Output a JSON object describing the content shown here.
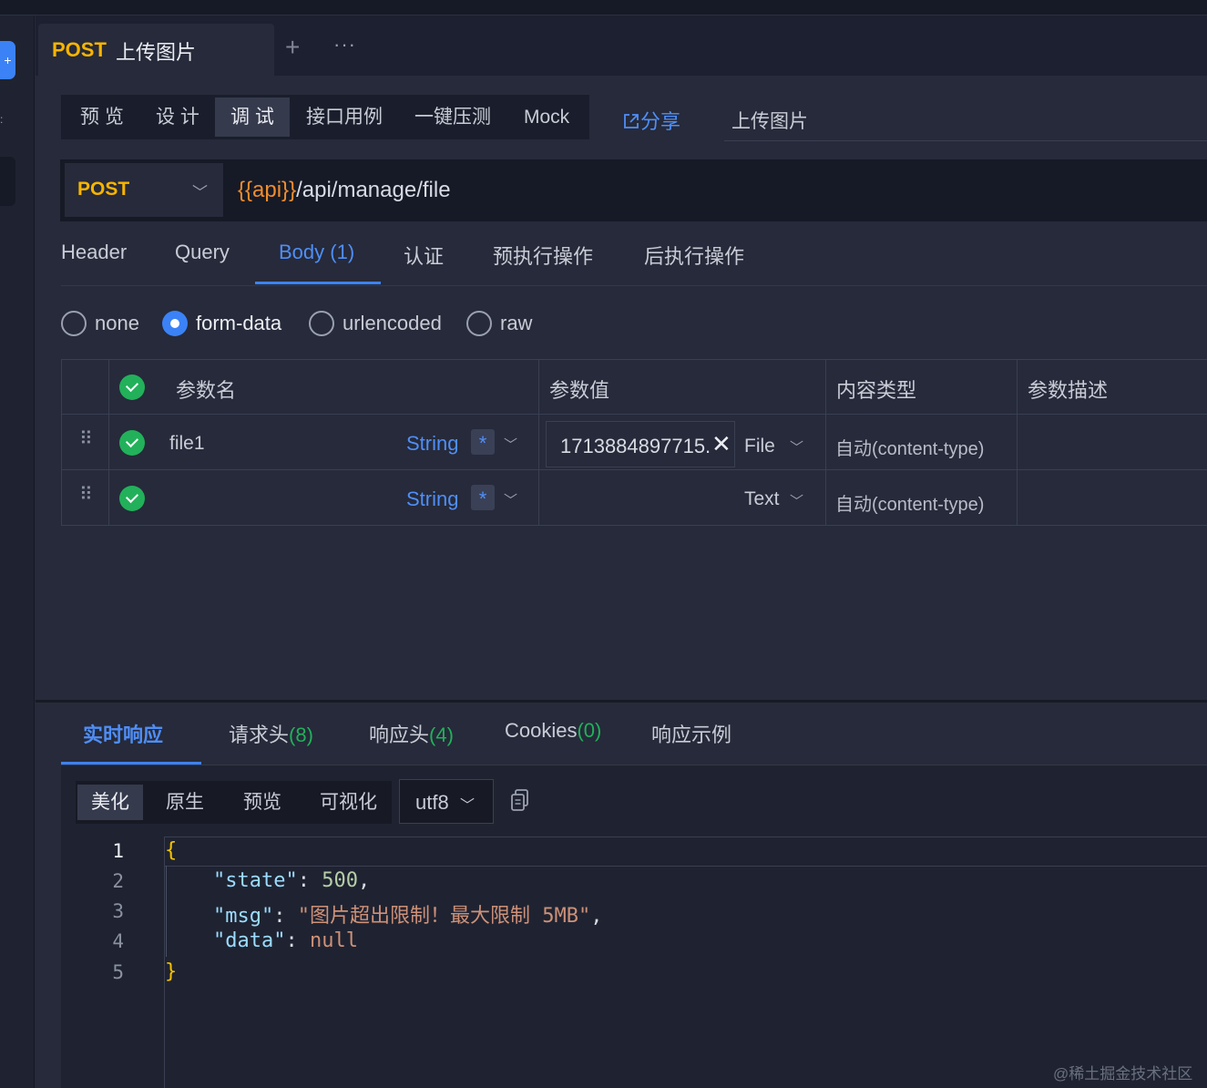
{
  "tab": {
    "method": "POST",
    "title": "上传图片",
    "add": "+",
    "more": "···"
  },
  "modes": [
    "预 览",
    "设 计",
    "调 试",
    "接口用例",
    "一键压测",
    "Mock"
  ],
  "share": "分享",
  "api_title": "上传图片",
  "request": {
    "method": "POST",
    "url_var": "{{api}}",
    "url_path": "/api/manage/file"
  },
  "req_tabs": {
    "header": "Header",
    "query": "Query",
    "body": "Body",
    "body_count": "(1)",
    "auth": "认证",
    "pre": "预执行操作",
    "post": "后执行操作"
  },
  "body_types": [
    "none",
    "form-data",
    "urlencoded",
    "raw"
  ],
  "table": {
    "headers": [
      "参数名",
      "参数值",
      "内容类型",
      "参数描述"
    ],
    "rows": [
      {
        "name": "file1",
        "type": "String",
        "required": "*",
        "value": "1713884897715.",
        "value_type": "File",
        "content_type": "自动(content-type)"
      },
      {
        "name": "",
        "type": "String",
        "required": "*",
        "value": "",
        "value_type": "Text",
        "content_type": "自动(content-type)"
      }
    ]
  },
  "resp_tabs": {
    "realtime": "实时响应",
    "req_headers": "请求头",
    "req_headers_count": "(8)",
    "resp_headers": "响应头",
    "resp_headers_count": "(4)",
    "cookies": "Cookies",
    "cookies_count": "(0)",
    "example": "响应示例"
  },
  "formats": [
    "美化",
    "原生",
    "预览",
    "可视化"
  ],
  "encoding": "utf8",
  "code": {
    "line_numbers": [
      "1",
      "2",
      "3",
      "4",
      "5"
    ],
    "open": "{",
    "k_state": "\"state\"",
    "v_state": "500",
    "k_msg": "\"msg\"",
    "v_msg": "\"图片超出限制！最大限制 5MB\"",
    "k_data": "\"data\"",
    "v_data": "null",
    "close": "}"
  },
  "watermark": "@稀土掘金技术社区"
}
